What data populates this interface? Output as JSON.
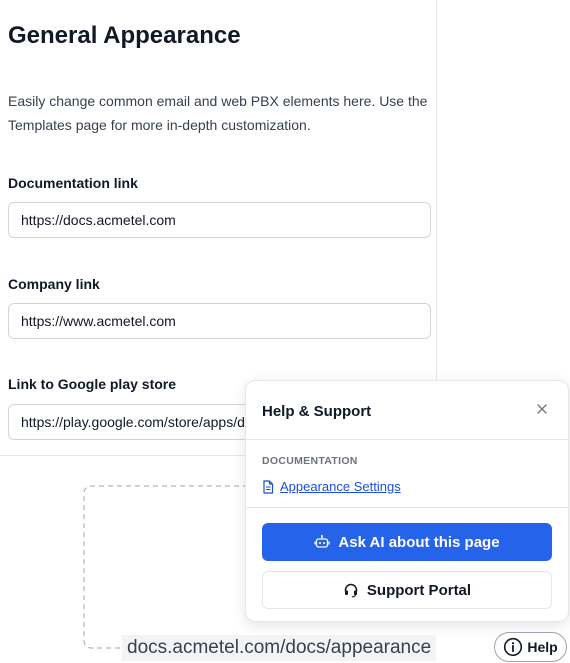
{
  "settings": {
    "title": "General Appearance",
    "description": "Easily change common email and web PBX elements here. Use the Templates page for more in-depth customization.",
    "fields": [
      {
        "label": "Documentation link",
        "value": "https://docs.acmetel.com"
      },
      {
        "label": "Company link",
        "value": "https://www.acmetel.com"
      },
      {
        "label": "Link to Google play store",
        "value": "https://play.google.com/store/apps/details?id=com.acmetel"
      }
    ]
  },
  "help_panel": {
    "title": "Help & Support",
    "close_icon": "close-icon",
    "section_label": "DOCUMENTATION",
    "doc_link": {
      "label": "Appearance Settings",
      "icon": "document-icon"
    },
    "ask_ai_button": {
      "label": "Ask AI about this page",
      "icon": "robot-icon"
    },
    "support_button": {
      "label": "Support Portal",
      "icon": "headset-icon"
    }
  },
  "url_label": "docs.acmetel.com/docs/appearance",
  "help_button": {
    "label": "Help",
    "icon": "info-icon"
  },
  "colors": {
    "primary": "#2563eb",
    "link": "#1d4ed8",
    "border": "#e5e7eb"
  }
}
